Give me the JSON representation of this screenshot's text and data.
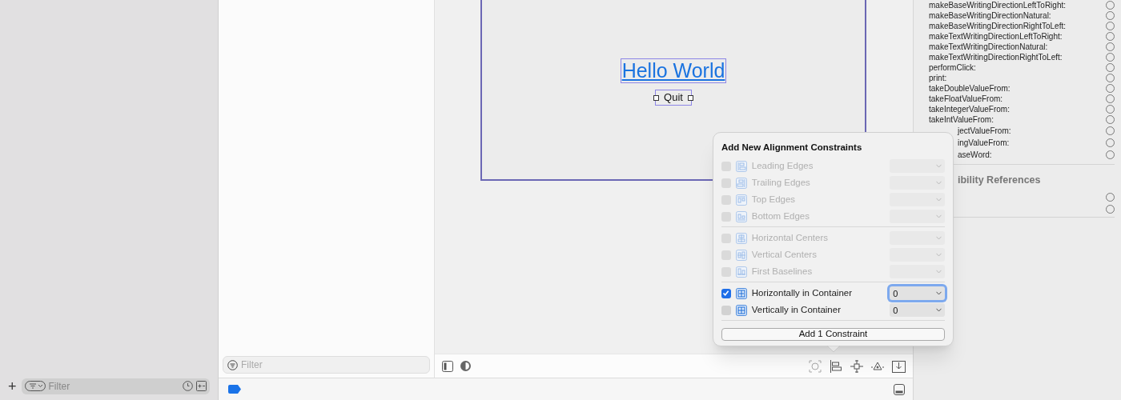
{
  "library": {
    "add_button": "+",
    "filter_placeholder": "Filter"
  },
  "outline": {
    "filter_placeholder": "Filter"
  },
  "canvas": {
    "label": "Hello World",
    "button": "Quit"
  },
  "inspector": {
    "actions": [
      {
        "name": "makeBaseWritingDirectionLeftToRight:",
        "kind": "full"
      },
      {
        "name": "makeBaseWritingDirectionNatural:",
        "kind": "full"
      },
      {
        "name": "makeBaseWritingDirectionRightToLeft:",
        "kind": "full"
      },
      {
        "name": "makeTextWritingDirectionLeftToRight:",
        "kind": "full"
      },
      {
        "name": "makeTextWritingDirectionNatural:",
        "kind": "full"
      },
      {
        "name": "makeTextWritingDirectionRightToLeft:",
        "kind": "full"
      },
      {
        "name": "performClick:",
        "kind": "full"
      },
      {
        "name": "print:",
        "kind": "full"
      },
      {
        "name": "takeDoubleValueFrom:",
        "kind": "full"
      },
      {
        "name": "takeFloatValueFrom:",
        "kind": "full"
      },
      {
        "name": "takeIntegerValueFrom:",
        "kind": "full"
      },
      {
        "name": "takeIntValueFrom:",
        "kind": "full"
      },
      {
        "name": "jectValueFrom:",
        "kind": "covered"
      },
      {
        "name": "ingValueFrom:",
        "kind": "covered"
      },
      {
        "name": "aseWord:",
        "kind": "covered"
      }
    ],
    "section_title": "ibility References"
  },
  "popover": {
    "title": "Add New Alignment Constraints",
    "groups": [
      [
        {
          "label": "Leading Edges",
          "checked": false,
          "disabled": true
        },
        {
          "label": "Trailing Edges",
          "checked": false,
          "disabled": true
        },
        {
          "label": "Top Edges",
          "checked": false,
          "disabled": true
        },
        {
          "label": "Bottom Edges",
          "checked": false,
          "disabled": true
        }
      ],
      [
        {
          "label": "Horizontal Centers",
          "checked": false,
          "disabled": true
        },
        {
          "label": "Vertical Centers",
          "checked": false,
          "disabled": true
        },
        {
          "label": "First Baselines",
          "checked": false,
          "disabled": true
        }
      ],
      [
        {
          "label": "Horizontally in Container",
          "checked": true,
          "disabled": false,
          "value": "0",
          "focused": true
        },
        {
          "label": "Vertically in Container",
          "checked": false,
          "disabled": false,
          "value": "0",
          "focused": false
        }
      ]
    ],
    "button": "Add 1 Constraint"
  }
}
